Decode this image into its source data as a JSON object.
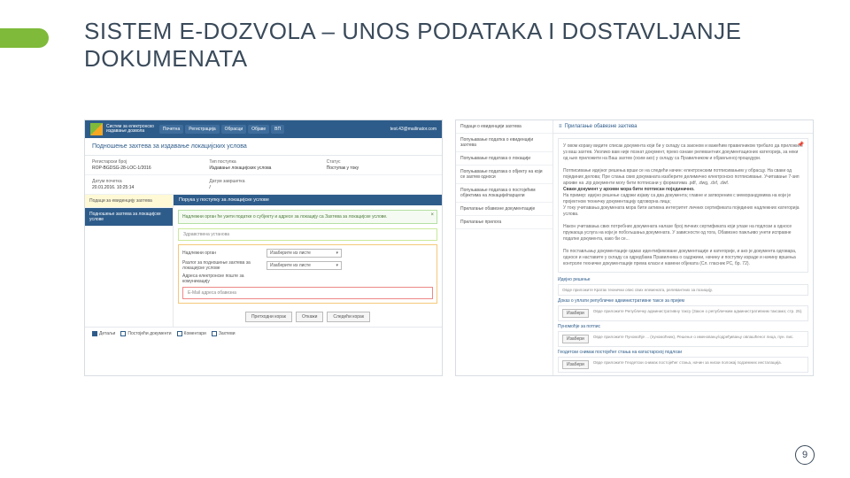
{
  "slide": {
    "title": "SISTEM E-DOZVOLA – UNOS PODATAKA I DOSTAVLJANJE DOKUMENATA",
    "page": "9"
  },
  "left": {
    "brand1": "Систем за електронско",
    "brand2": "издавање дозвола",
    "nav": [
      "Почетна",
      "Регистрација",
      "Обрасци",
      "Објаве",
      "ВП"
    ],
    "user": "test.43@mailinator.com",
    "section": "Подношење захтева за издавање локацијских услова",
    "fields": {
      "c1l": "Регистарски број",
      "c1v": "ROP-BGDSG-28-LOC-1/2016",
      "c2l": "Тип поступка",
      "c2v": "Издавање локацијских услова",
      "c3l": "Статус",
      "c3v": "Поступак у току"
    },
    "fields2": {
      "c1l": "Датум почетка",
      "c1v": "20.01.2016. 10:25:14",
      "c2l": "Датум завршетка",
      "c2v": "/"
    },
    "tabs": [
      "Подаци за евиденцију захтева",
      "Подношење захтева за локацијске услове"
    ],
    "blueBar": "Порука у поступку за локацијске услове",
    "info": "Надлежни орган ће узети податке о субјекту и адресе за локацију са Захтева за локацијске услове.",
    "lime": "Здравствена установа",
    "form": {
      "r1": "Надлежни орган",
      "r1v": "Изаберите из листе",
      "r2": "Разлог за подношење захтева за локацијске услове",
      "r2v": "Изаберите из листе",
      "r3": "Адреса електронске поште за комуникацију",
      "red": "Е-Mail адреса обавезна"
    },
    "btns": [
      "Претходни корак",
      "Откажи",
      "Следећи корак"
    ],
    "ftabs": [
      "Детаљи",
      "Постојећи документи",
      "Коментари",
      "Захтеви"
    ]
  },
  "right": {
    "sideTitle": "Подаци о евиденцији захтева",
    "items": [
      "Попуњавање податка о евиденцији захтева",
      "Попуњавање података о локацији",
      "Попуњавање података о објекту на који се захтев односи",
      "Попуњавање података о постојећим објектима на локацији/парцели",
      "Прилагање обавезне документације",
      "Прилагање прилога"
    ],
    "head": "Прилагање обавезне захтева",
    "note": {
      "p1": "У овом кораку видите списак документа који би у складу са законом и важећим правилником требало да приложите уз ваш захтев. Уколико вам није познат документ, преко ознаке релевантних документационих категорија, за неки од њих приложити на Ваш захтев (осим ако) у складу са Правилником и објављеној процедури.",
      "p2": "Потписивање идејног решења врши се на следећи начин: електронским потписивањем у обрасцу. На сваки од појединих делова; Пре слања свих докуманата изаберите делимично електронско потписивање. Учитавање 7-зип архиве на .zip документи могу бити потписани у форматима .pdf, .dwg, .dxf, .dwf.",
      "b": "Сваки документ у архиви мора бити потписан појединачно.",
      "p3": "На пример: идејно решење садржи изјаву са два документа; главне и затвореним с меморандумима на који је пројектном техничку документацију одговорна лица;",
      "p4": "У току учитавања докумената мора бити активна интегритет личних сертификата појединих надлежних категорија услова.",
      "p5": "Након учитавања свих потребних докумената налазе број личних сертификата који улазе на подлози а односе пружаоца услуга на који је побољшања докумената. У зависности од тога, Обавезно пажљиво унети исправне податке документа, како би се...",
      "p6": "По постављању документације одмах идентификоване документације и категорије, и ако је документа одговара, односе и наставите у складу са одредбама Правилника о садржини, начину и поступку израде и начину вршења контроле техничке документације према класи и намени објеката (Сл. гласник РС, бр. 72)."
    },
    "groups": [
      {
        "h": "Идејно решење",
        "btn": "",
        "txt": "Овде приложите Кратак технички опис свих елемената, релевантних за позицију."
      },
      {
        "h": "Доказ о уплати републичке административне таксе за пријем",
        "btn": "Изабери",
        "txt": "Овде приложите Републичку административну таксу (Закон о републичким административним таксама; стр. 25)."
      },
      {
        "h": "Пуномоћје за потпис",
        "btn": "Изабери",
        "txt": "Овде приложите Пуномоћје ... (пуномоћник), Решење о именовању/одређивању овлашћеног лица, пун. пис."
      },
      {
        "h": "Геодетски снимак постојећег стања на катастарској подлози",
        "btn": "Изабери",
        "txt": "Овде приложите Геодетски снимак постојећег стања, начин за ниски положај подземних инсталација."
      }
    ]
  }
}
